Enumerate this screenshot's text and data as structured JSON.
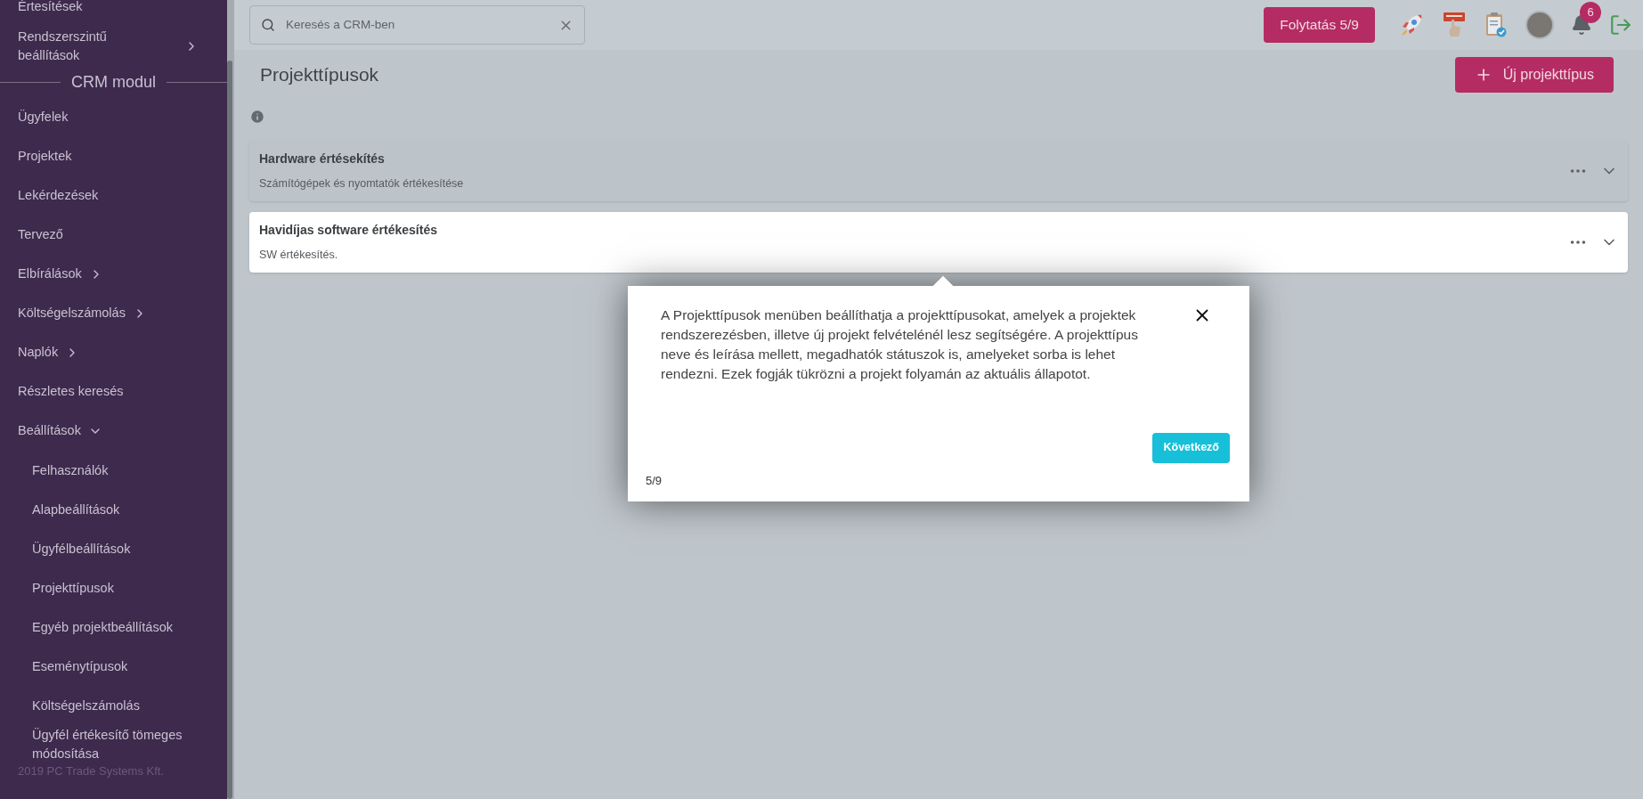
{
  "sidebar": {
    "items": [
      {
        "label": "Értesítések"
      },
      {
        "label": "Rendszerszintű beállítások",
        "expanded": false
      },
      {
        "kind": "heading",
        "label": "CRM modul"
      },
      {
        "label": "Ügyfelek"
      },
      {
        "label": "Projektek"
      },
      {
        "label": "Lekérdezések"
      },
      {
        "label": "Tervező"
      },
      {
        "label": "Elbírálások",
        "expanded": false
      },
      {
        "label": "Költségelszámolás",
        "expanded": false
      },
      {
        "label": "Naplók",
        "expanded": false
      },
      {
        "label": "Részletes keresés"
      },
      {
        "label": "Beállítások",
        "expanded": true,
        "children": [
          {
            "label": "Felhasználók"
          },
          {
            "label": "Alapbeállítások"
          },
          {
            "label": "Ügyfélbeállítások"
          },
          {
            "label": "Projekttípusok"
          },
          {
            "label": "Egyéb projektbeállítások"
          },
          {
            "label": "Eseménytípusok"
          },
          {
            "label": "Költségelszámolás"
          },
          {
            "label": "Ügyfél értékesítő tömeges módosítása"
          }
        ]
      }
    ],
    "footer": "2019 PC Trade Systems Kft."
  },
  "search": {
    "placeholder": "Keresés a CRM-ben"
  },
  "topbar": {
    "continue_button": "Folytatás 5/9",
    "notifications": "6"
  },
  "page": {
    "title": "Projekttípusok",
    "new_button": "Új projekttípus"
  },
  "project_types": [
    {
      "name": "Hardware értésekítés",
      "description": "Számítógépek és nyomtatók értékesítése",
      "highlighted": false
    },
    {
      "name": "Havidíjas software értékesítés",
      "description": "SW értékesítés.",
      "highlighted": true
    }
  ],
  "tour": {
    "text": "A Projekttípusok menüben beállíthatja a projekttípusokat, amelyek a projektek rendszerezésben, illetve új projekt felvételénél lesz segítségére. A projekttípus neve és leírása mellett, megadhatók státuszok is, amelyeket sorba is lehet rendezni. Ezek fogják tükrözni a projekt folyamán az aktuális állapotot.",
    "next_button": "Következő",
    "step": "5/9"
  }
}
